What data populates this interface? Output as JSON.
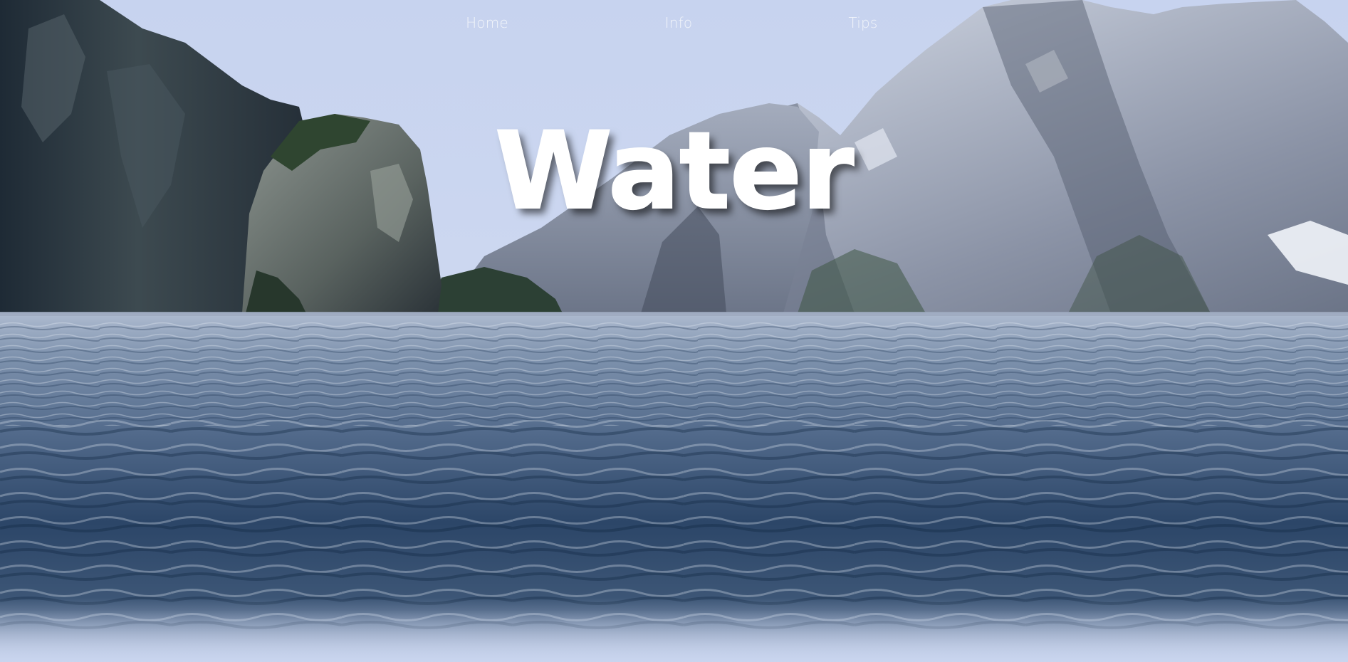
{
  "nav": {
    "items": [
      {
        "label": "Home"
      },
      {
        "label": "Info"
      },
      {
        "label": "Tips"
      }
    ]
  },
  "hero": {
    "title": "Water"
  },
  "colors": {
    "sky": "#c9d5ef",
    "nav_text": "#f3f6fb",
    "title": "#ffffff",
    "water_dark": "#1f3a5d",
    "water_light": "#b7c4d9"
  }
}
